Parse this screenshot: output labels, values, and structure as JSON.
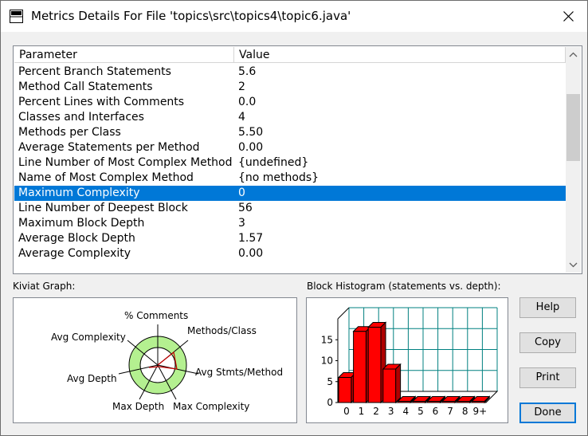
{
  "window": {
    "title": "Metrics Details For File 'topics\\src\\topics4\\topic6.java'"
  },
  "table": {
    "headers": [
      "Parameter",
      "Value"
    ],
    "rows": [
      {
        "param": "Percent Branch Statements",
        "value": "5.6"
      },
      {
        "param": "Method Call Statements",
        "value": "2"
      },
      {
        "param": "Percent Lines with Comments",
        "value": "0.0"
      },
      {
        "param": "Classes and Interfaces",
        "value": "4"
      },
      {
        "param": "Methods per Class",
        "value": "5.50"
      },
      {
        "param": "Average Statements per Method",
        "value": "0.00"
      },
      {
        "param": "Line Number of Most Complex Method",
        "value": "{undefined}"
      },
      {
        "param": "Name of Most Complex Method",
        "value": "{no methods}"
      },
      {
        "param": "Maximum Complexity",
        "value": "0"
      },
      {
        "param": "Line Number of Deepest Block",
        "value": "56"
      },
      {
        "param": "Maximum Block Depth",
        "value": "3"
      },
      {
        "param": "Average Block Depth",
        "value": "1.57"
      },
      {
        "param": "Average Complexity",
        "value": "0.00"
      }
    ],
    "selected_index": 8,
    "selection_color": "#0078d7"
  },
  "kiviat": {
    "label": "Kiviat Graph:",
    "axes": [
      "% Comments",
      "Methods/Class",
      "Avg Stmts/Method",
      "Max Complexity",
      "Max Depth",
      "Avg Depth",
      "Avg Complexity"
    ],
    "band_color": "#b4f090"
  },
  "histogram": {
    "label": "Block Histogram (statements vs. depth):",
    "bar_color": "#ff0000",
    "grid_color": "#008080"
  },
  "chart_data": {
    "type": "bar",
    "title": "Block Histogram (statements vs. depth):",
    "categories": [
      "0",
      "1",
      "2",
      "3",
      "4",
      "5",
      "6",
      "7",
      "8",
      "9+"
    ],
    "values": [
      6,
      17,
      18,
      8,
      0,
      0,
      0,
      0,
      0,
      0
    ],
    "ylim": [
      0,
      20
    ],
    "yticks": [
      "0",
      "5",
      "10",
      "15"
    ],
    "grid": true
  },
  "buttons": {
    "help": "Help",
    "copy": "Copy",
    "print": "Print",
    "done": "Done"
  }
}
